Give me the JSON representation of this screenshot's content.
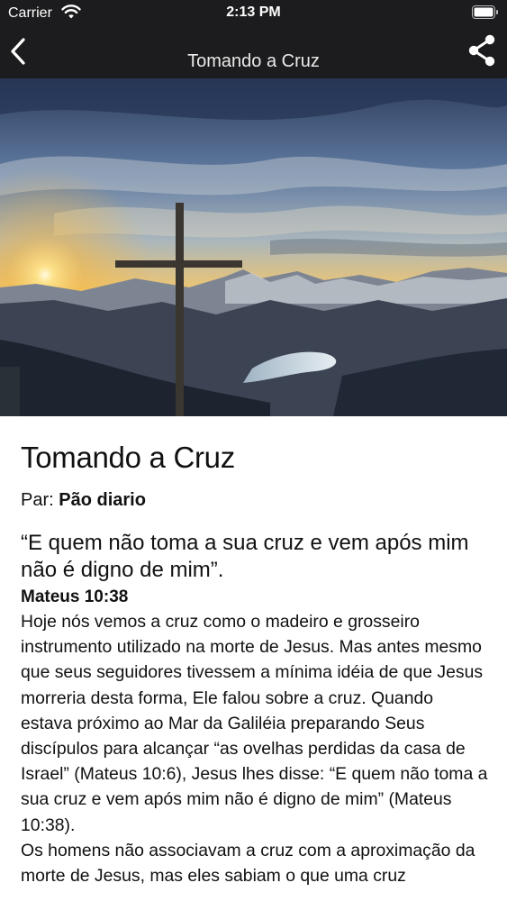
{
  "status_bar": {
    "carrier": "Carrier",
    "time": "2:13 PM",
    "icons": [
      "wifi-icon",
      "battery-icon"
    ]
  },
  "nav": {
    "title": "Tomando a Cruz",
    "back_icon": "chevron-left-icon",
    "share_icon": "share-icon",
    "background": "#1c1c1e"
  },
  "article": {
    "title": "Tomando a Cruz",
    "byline_prefix": "Par:",
    "author": "Pão diario",
    "quote": "“E quem não toma a sua cruz e vem após mim não é digno de mim”.",
    "reference": "Mateus 10:38",
    "paragraphs": [
      "Hoje nós vemos a cruz como o madeiro e grosseiro instrumento utilizado na morte de Jesus. Mas antes mesmo que seus seguidores tivessem a mínima idéia de que Jesus morreria desta forma, Ele falou sobre a cruz. Quando estava próximo ao Mar da Galiléia preparando Seus discípulos para alcançar “as ovelhas perdidas da casa de Israel” (Mateus 10:6), Jesus lhes disse: “E quem não toma a sua cruz e vem após mim não é digno de mim” (Mateus 10:38).",
      "Os homens não associavam a cruz com a aproximação da morte de Jesus, mas eles sabiam o que uma cruz"
    ]
  }
}
